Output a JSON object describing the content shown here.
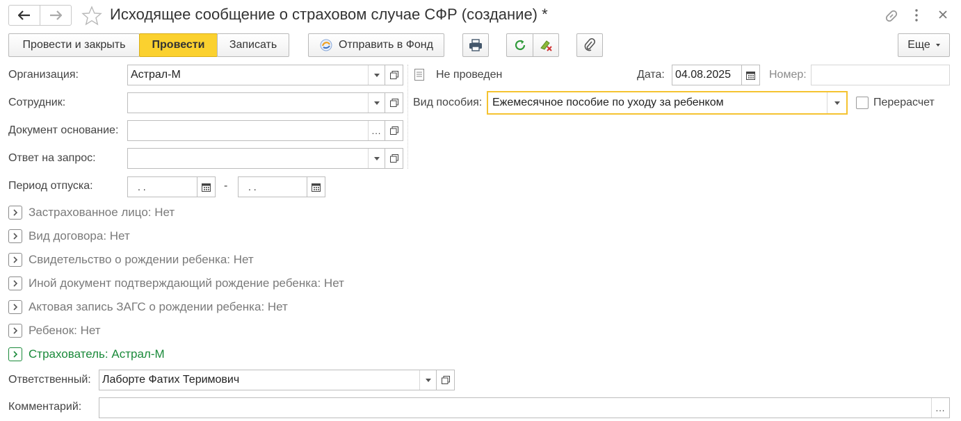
{
  "window": {
    "title": "Исходящее сообщение о страховом случае СФР (создание) *"
  },
  "toolbar": {
    "post_and_close": "Провести и закрыть",
    "post": "Провести",
    "save": "Записать",
    "send_to_fund": "Отправить в Фонд",
    "more": "Еще"
  },
  "form": {
    "organization_label": "Организация:",
    "organization_value": "Астрал-М",
    "employee_label": "Сотрудник:",
    "employee_value": "",
    "base_doc_label": "Документ основание:",
    "base_doc_value": "",
    "reply_label": "Ответ на запрос:",
    "reply_value": "",
    "leave_period_label": "Период отпуска:",
    "leave_from": " .  .",
    "leave_dash": "-",
    "leave_to": " .  .",
    "status_text": "Не проведен",
    "date_label": "Дата:",
    "date_value": "04.08.2025",
    "number_label": "Номер:",
    "number_value": "",
    "benefit_label": "Вид пособия:",
    "benefit_value": "Ежемесячное пособие по уходу за ребенком",
    "recalc_label": "Перерасчет",
    "responsible_label": "Ответственный:",
    "responsible_value": "Лаборте Фатих Теримович",
    "comment_label": "Комментарий:",
    "comment_value": ""
  },
  "groups": [
    {
      "label": "Застрахованное лицо: Нет",
      "color": "#7a7a7a"
    },
    {
      "label": "Вид договора: Нет",
      "color": "#7a7a7a"
    },
    {
      "label": "Свидетельство о рождении ребенка: Нет",
      "color": "#7a7a7a"
    },
    {
      "label": "Иной документ подтверждающий рождение ребенка: Нет",
      "color": "#7a7a7a"
    },
    {
      "label": "Актовая запись ЗАГС о рождении ребенка: Нет",
      "color": "#7a7a7a"
    },
    {
      "label": "Ребенок: Нет",
      "color": "#7a7a7a"
    },
    {
      "label": "Страхователь: Астрал-М",
      "color": "#1a8a3a"
    }
  ],
  "colors": {
    "accent": "#fbd12f",
    "focus": "#f5c330",
    "green": "#1a8a3a"
  }
}
